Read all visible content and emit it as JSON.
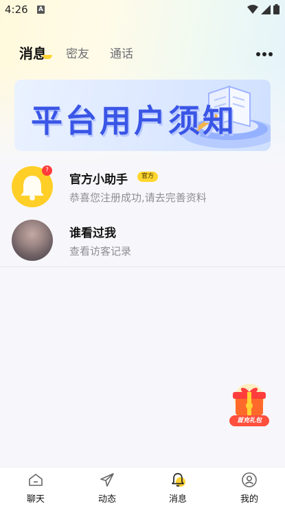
{
  "status_bar": {
    "time": "4:26",
    "a_icon": "A"
  },
  "tabs": [
    {
      "label": "消息",
      "active": true
    },
    {
      "label": "密友",
      "active": false
    },
    {
      "label": "通话",
      "active": false
    }
  ],
  "banner": {
    "title": "平台用户须知"
  },
  "messages": [
    {
      "title": "官方小助手",
      "tag": "官方",
      "subtitle": "恭喜您注册成功,请去完善资料",
      "badge": "?"
    },
    {
      "title": "谁看过我",
      "subtitle": "查看访客记录"
    }
  ],
  "gift": {
    "label": "首充礼包"
  },
  "bottom_nav": [
    {
      "label": "聊天",
      "icon": "home-icon"
    },
    {
      "label": "动态",
      "icon": "send-icon"
    },
    {
      "label": "消息",
      "icon": "bell-icon",
      "active": true
    },
    {
      "label": "我的",
      "icon": "profile-icon"
    }
  ],
  "colors": {
    "accent_yellow": "#ffd335",
    "banner_blue": "#3a56e6",
    "badge_red": "#ff3b3b"
  }
}
